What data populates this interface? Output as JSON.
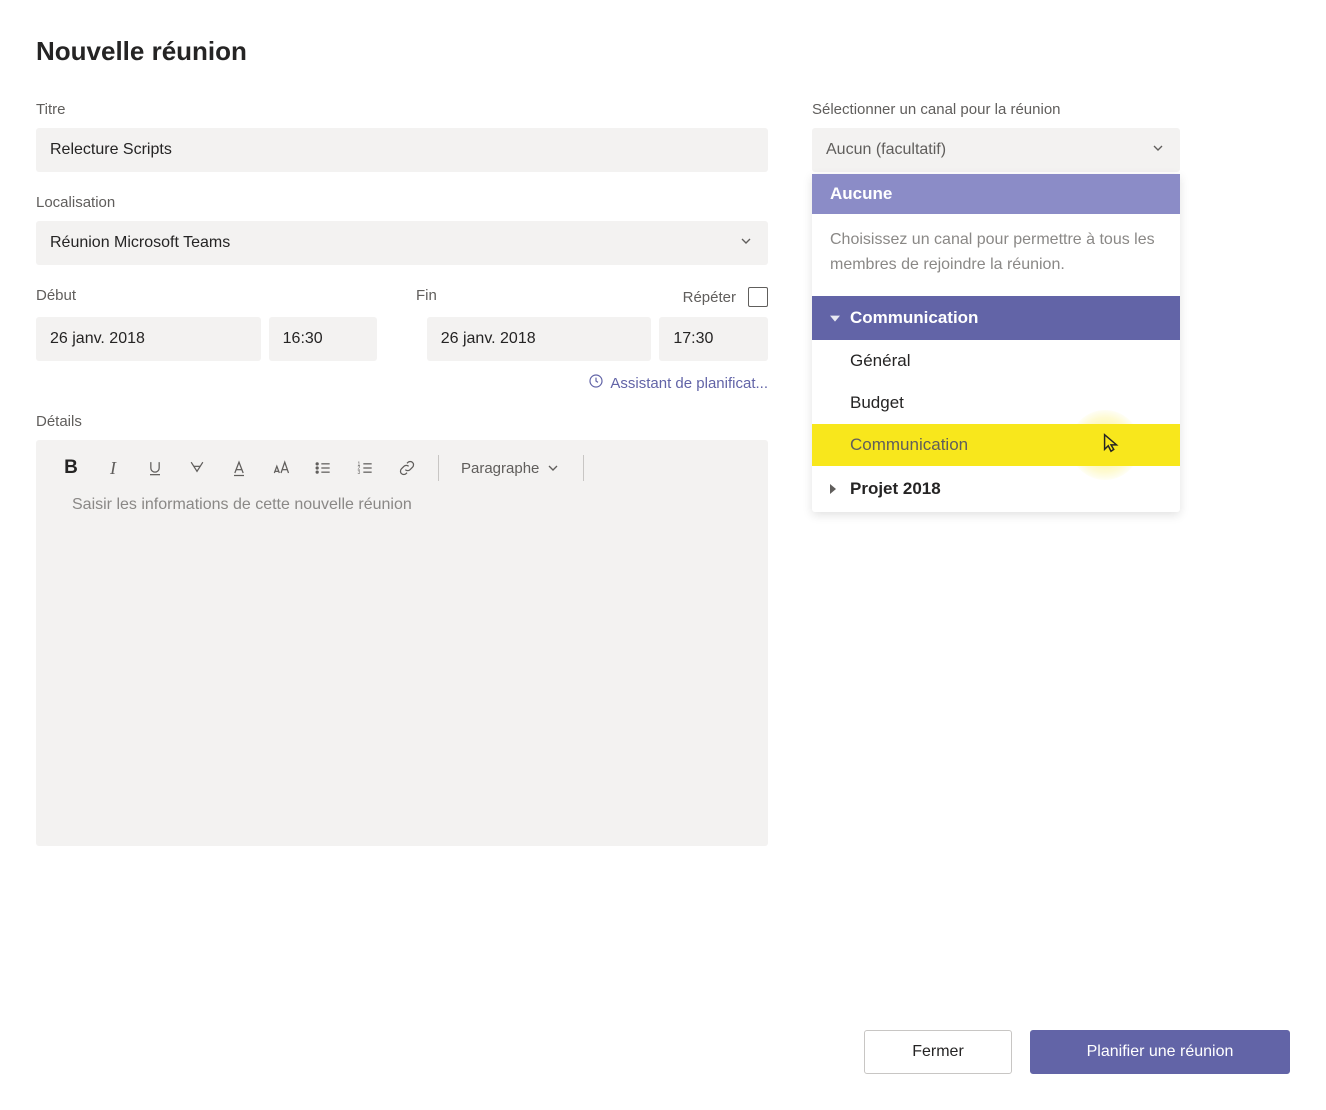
{
  "header": {
    "title": "Nouvelle réunion"
  },
  "fields": {
    "title_label": "Titre",
    "title_value": "Relecture Scripts",
    "location_label": "Localisation",
    "location_value": "Réunion Microsoft Teams",
    "start_label": "Début",
    "end_label": "Fin",
    "repeat_label": "Répéter",
    "start_date": "26 janv. 2018",
    "start_time": "16:30",
    "end_date": "26 janv. 2018",
    "end_time": "17:30",
    "assist_label": "Assistant de planificat...",
    "details_label": "Détails",
    "details_placeholder": "Saisir les informations de cette nouvelle réunion"
  },
  "toolbar": {
    "bold": "B",
    "italic": "I",
    "paragraph_label": "Paragraphe"
  },
  "channel": {
    "label": "Sélectionner un canal pour la réunion",
    "selected": "Aucun (facultatif)",
    "none_label": "Aucune",
    "description": "Choisissez un canal pour permettre à tous les membres de rejoindre la réunion.",
    "team_expanded": "Communication",
    "channels": [
      "Général",
      "Budget",
      "Communication"
    ],
    "team_collapsed": "Projet 2018"
  },
  "footer": {
    "close": "Fermer",
    "schedule": "Planifier une réunion"
  }
}
